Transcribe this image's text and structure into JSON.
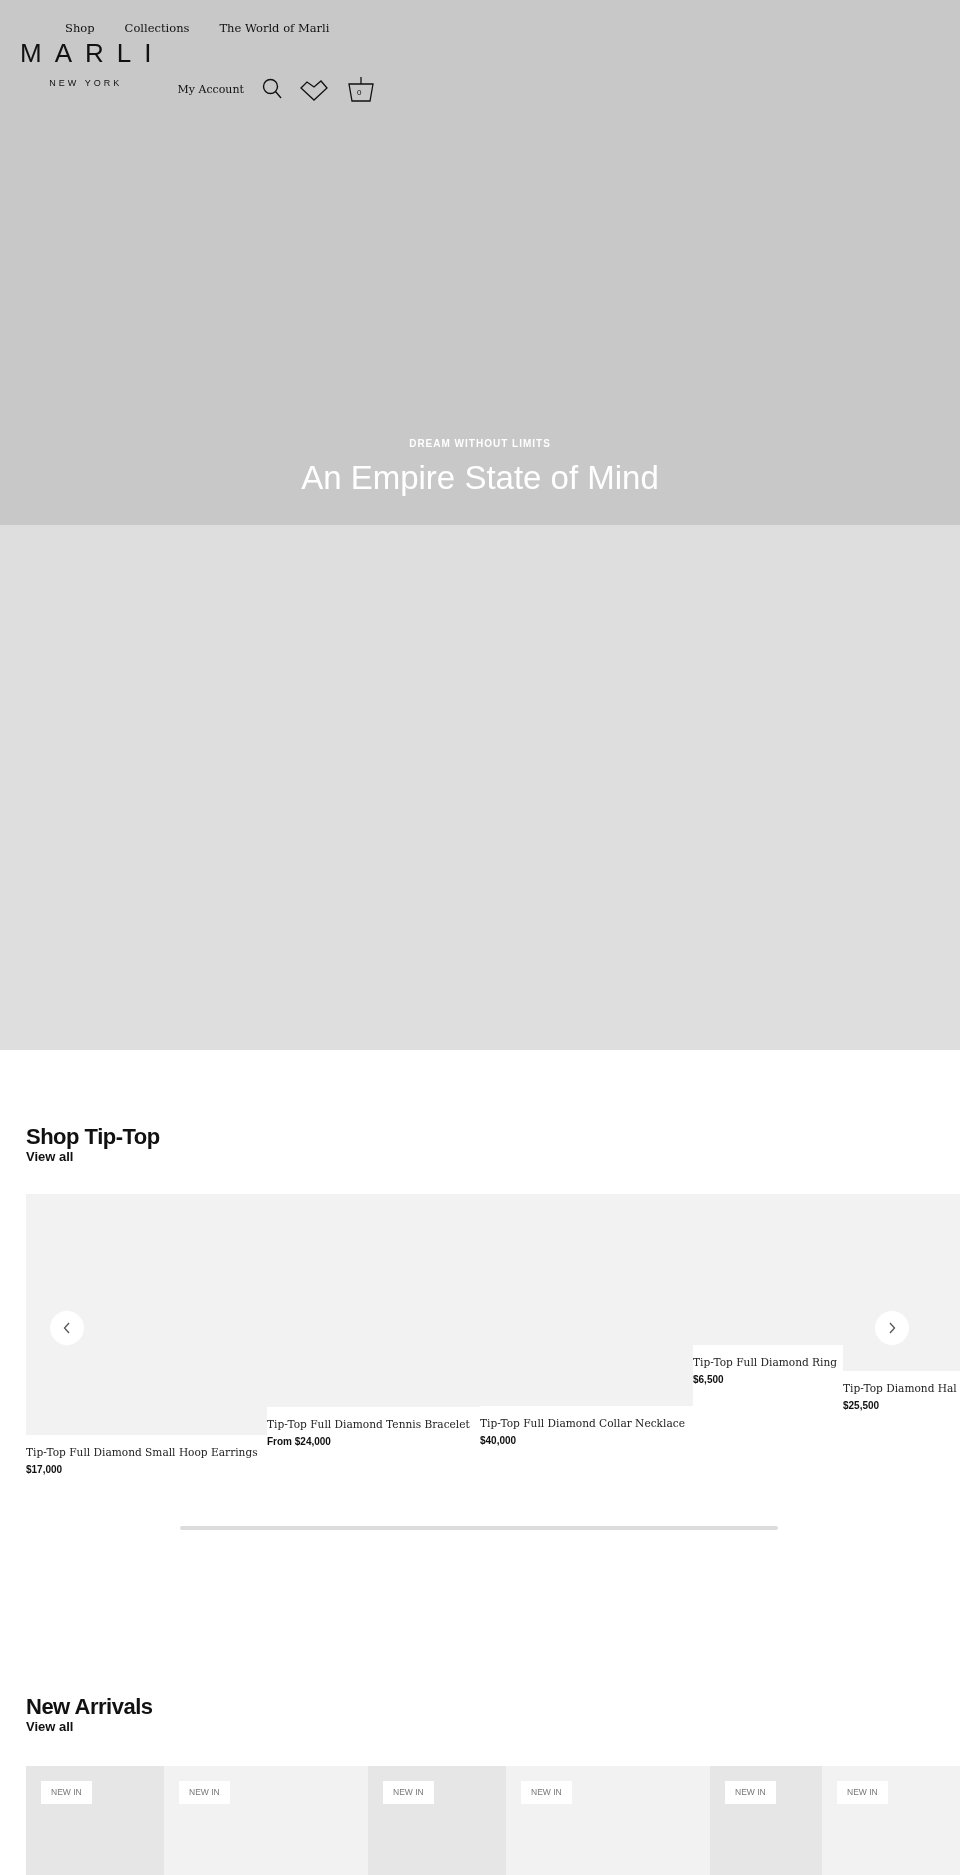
{
  "header": {
    "nav": [
      {
        "label": "Shop"
      },
      {
        "label": "Collections"
      },
      {
        "label": "The World of Marli"
      }
    ],
    "logo": {
      "name": "MARLI",
      "tagline": "NEW YORK"
    },
    "account_link": "My Account",
    "cart_count": "0"
  },
  "hero": {
    "eyebrow": "DREAM WITHOUT LIMITS",
    "title": "An Empire State of Mind"
  },
  "sections": [
    {
      "kind": "carousel",
      "title": "Shop Tip-Top",
      "link": "View all",
      "products": [
        {
          "name": "Tip-Top Full Diamond Small Hoop Earrings",
          "price": "$17,000"
        },
        {
          "name": "Tip-Top Full Diamond Tennis Bracelet",
          "price": "From $24,000"
        },
        {
          "name": "Tip-Top Full Diamond Collar Necklace",
          "price": "$40,000"
        },
        {
          "name": "Tip-Top Full Diamond Ring",
          "price": "$6,500"
        },
        {
          "name": "Tip-Top Diamond Hal",
          "price": "$25,500"
        }
      ]
    },
    {
      "kind": "tiles",
      "title": "New Arrivals",
      "link": "View all",
      "tiles": [
        {
          "badge": "NEW IN"
        },
        {
          "badge": "NEW IN"
        },
        {
          "badge": "NEW IN"
        },
        {
          "badge": "NEW IN"
        },
        {
          "badge": "NEW IN"
        },
        {
          "badge": "NEW IN"
        }
      ]
    }
  ]
}
